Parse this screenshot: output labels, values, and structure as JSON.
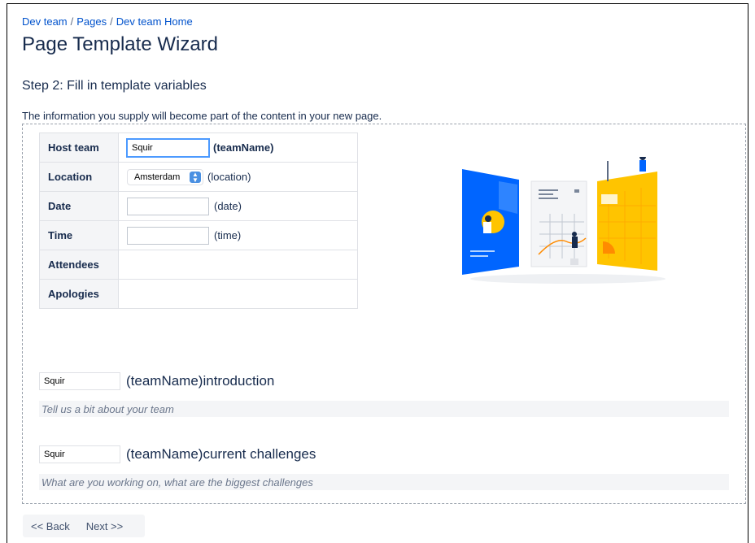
{
  "breadcrumb": {
    "items": [
      "Dev team",
      "Pages",
      "Dev team Home"
    ],
    "separator": "/"
  },
  "page_title": "Page Template Wizard",
  "step_title": "Step 2: Fill in template variables",
  "intro_text": "The information you supply will become part of the content in your new page.",
  "table": {
    "rows": [
      {
        "label": "Host team",
        "input_value": "Squir",
        "var": "(teamName)"
      },
      {
        "label": "Location",
        "select_value": "Amsterdam",
        "var": "(location)"
      },
      {
        "label": "Date",
        "input_value": "",
        "var": "(date)"
      },
      {
        "label": "Time",
        "input_value": "",
        "var": "(time)"
      },
      {
        "label": "Attendees"
      },
      {
        "label": "Apologies"
      }
    ]
  },
  "sections": [
    {
      "input_value": "Squir",
      "label": "(teamName)introduction",
      "placeholder": "Tell us a bit about your team"
    },
    {
      "input_value": "Squir",
      "label": "(teamName)current challenges",
      "placeholder": "What are you working on, what are the biggest challenges"
    }
  ],
  "nav": {
    "back_label": "<< Back",
    "next_label": "Next >>"
  },
  "colors": {
    "link": "#0052cc",
    "text": "#172b4d",
    "accent_blue": "#0065ff",
    "accent_yellow": "#ffc400"
  }
}
